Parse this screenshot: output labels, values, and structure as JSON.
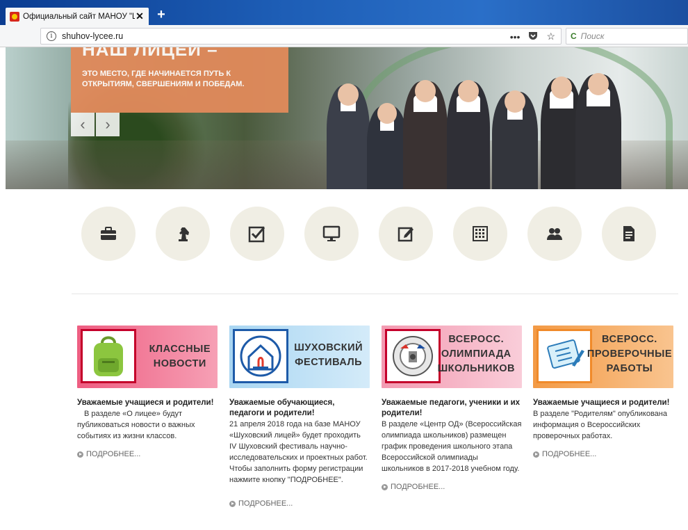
{
  "browser": {
    "tab_title": "Официальный сайт МАНОУ \"Ш",
    "close_label": "✕",
    "newtab_label": "+",
    "url": "shuhov-lycee.ru",
    "page_actions": [
      "•••",
      "♥",
      "☆"
    ],
    "search_placeholder": "Поиск"
  },
  "hero": {
    "heading": "НАШ ЛИЦЕЙ –",
    "subtitle_line1": "ЭТО МЕСТО, ГДЕ НАЧИНАЕТСЯ ПУТЬ К",
    "subtitle_line2": "ОТКРЫТИЯМ, СВЕРШЕНИЯМ И ПОБЕДАМ.",
    "prev": "‹",
    "next": "›"
  },
  "icons": [
    {
      "name": "briefcase-icon"
    },
    {
      "name": "chess-knight-icon"
    },
    {
      "name": "checkbox-icon"
    },
    {
      "name": "monitor-icon"
    },
    {
      "name": "edit-icon"
    },
    {
      "name": "calendar-icon"
    },
    {
      "name": "users-icon"
    },
    {
      "name": "document-icon"
    }
  ],
  "cards": [
    {
      "title_l1": "КЛАССНЫЕ",
      "title_l2": "НОВОСТИ",
      "heading": "Уважаемые учащиеся и родители!",
      "text": "В разделе «О лицее» будут публиковаться новости о важных событиях из жизни классов.",
      "more": "ПОДРОБНЕЕ..."
    },
    {
      "title_l1": "ШУХОВСКИЙ",
      "title_l2": "ФЕСТИВАЛЬ",
      "heading": "Уважаемые обучающиеся, педагоги и родители!",
      "text": "21 апреля 2018 года на базе МАНОУ «Шуховский лицей» будет проходить IV Шуховский фестиваль научно-исследовательских и проектных работ.",
      "text2": "Чтобы заполнить форму регистрации нажмите кнопку \"ПОДРОБНЕЕ\".",
      "more": "ПОДРОБНЕЕ..."
    },
    {
      "title_l1": "ВСЕРОСС.",
      "title_l2": "ОЛИМПИАДА",
      "title_l3": "ШКОЛЬНИКОВ",
      "heading": "Уважаемые педагоги, ученики и их родители!",
      "text": "В разделе «Центр ОД» (Всероссийская олимпиада школьников) размещен график проведения школьного этапа Всероссийской олимпиады школьников в 2017-2018 учебном году.",
      "more": "ПОДРОБНЕЕ..."
    },
    {
      "title_l1": "ВСЕРОСС.",
      "title_l2": "ПРОВЕРОЧНЫЕ",
      "title_l3": "РАБОТЫ",
      "heading": "Уважаемые учащиеся и родители!",
      "text": "В разделе \"Родителям\" опубликована информация о Всероссийских проверочных работах.",
      "more": "ПОДРОБНЕЕ..."
    }
  ],
  "colors": {
    "card1": "#f06b8c",
    "card2": "#bfe0f6",
    "card3": "#f7b7c6",
    "card4": "#f6a95c",
    "hero_box": "#e08a5b",
    "icon_bg": "#f0eee4"
  }
}
